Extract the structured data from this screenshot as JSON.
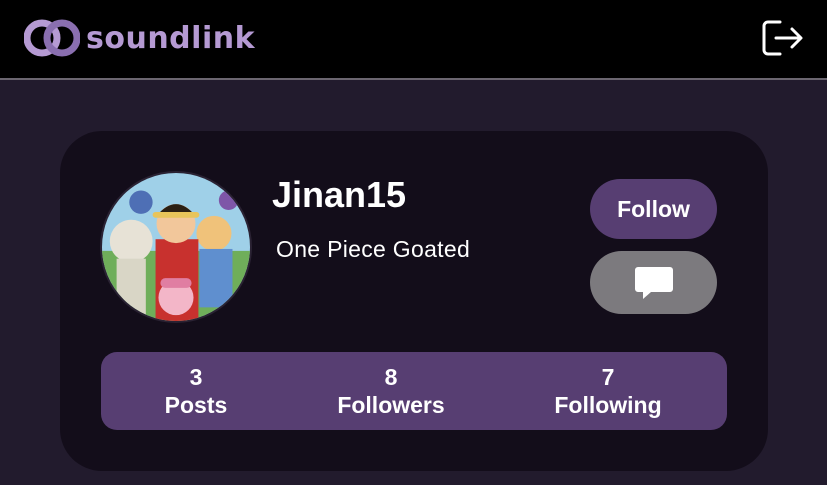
{
  "header": {
    "app_name": "soundlink",
    "logo_icon": "linked-rings-logo",
    "logout_icon": "logout-icon"
  },
  "profile": {
    "username": "Jinan15",
    "bio": "One Piece Goated",
    "avatar_icon": "profile-avatar-image",
    "follow_label": "Follow",
    "message_icon": "chat-bubble-icon"
  },
  "stats": [
    {
      "value": "3",
      "label": "Posts"
    },
    {
      "value": "8",
      "label": "Followers"
    },
    {
      "value": "7",
      "label": "Following"
    }
  ],
  "colors": {
    "background": "#221b2d",
    "topbar": "#000000",
    "card": "#130d1a",
    "accent": "#573e72",
    "brand_text": "#b59ad3",
    "message_button": "#7c7a7e"
  }
}
